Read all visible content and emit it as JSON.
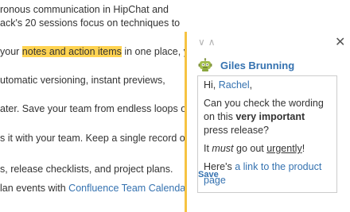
{
  "document": {
    "line1": "ronous communication in HipChat and",
    "line2": "ack's 20 sessions focus on techniques to",
    "line3_pre": "your ",
    "line3_highlight": "notes and action items",
    "line3_post": " in one place, you",
    "line4": "utomatic versioning, instant previews,",
    "line5": "ater. Save your team from endless loops of",
    "line6": "s it with your team. Keep a single record of",
    "line7": "s, release checklists, and project plans.",
    "line8_pre": "lan events with ",
    "line8_link": "Confluence Team Calendars",
    "line8_post": "."
  },
  "comment": {
    "prev_label": "∨",
    "next_label": "∧",
    "close_label": "✕",
    "author": "Giles Brunning",
    "greeting_pre": "Hi, ",
    "greeting_mention": "Rachel",
    "greeting_post": ",",
    "p2_pre": "Can you check the wording on this ",
    "p2_bold": "very important",
    "p2_post": " press release?",
    "p3_pre": "It ",
    "p3_italic": "must",
    "p3_mid": " go out ",
    "p3_underline": "urgently",
    "p3_post": "!",
    "p4_pre": "Here's ",
    "p4_link": "a link to the product page",
    "save_label": "Save"
  },
  "colors": {
    "highlight": "#ffd351",
    "link": "#3572b0",
    "panel_accent": "#f6c342"
  },
  "icons": {
    "avatar": "robot-avatar-icon"
  }
}
